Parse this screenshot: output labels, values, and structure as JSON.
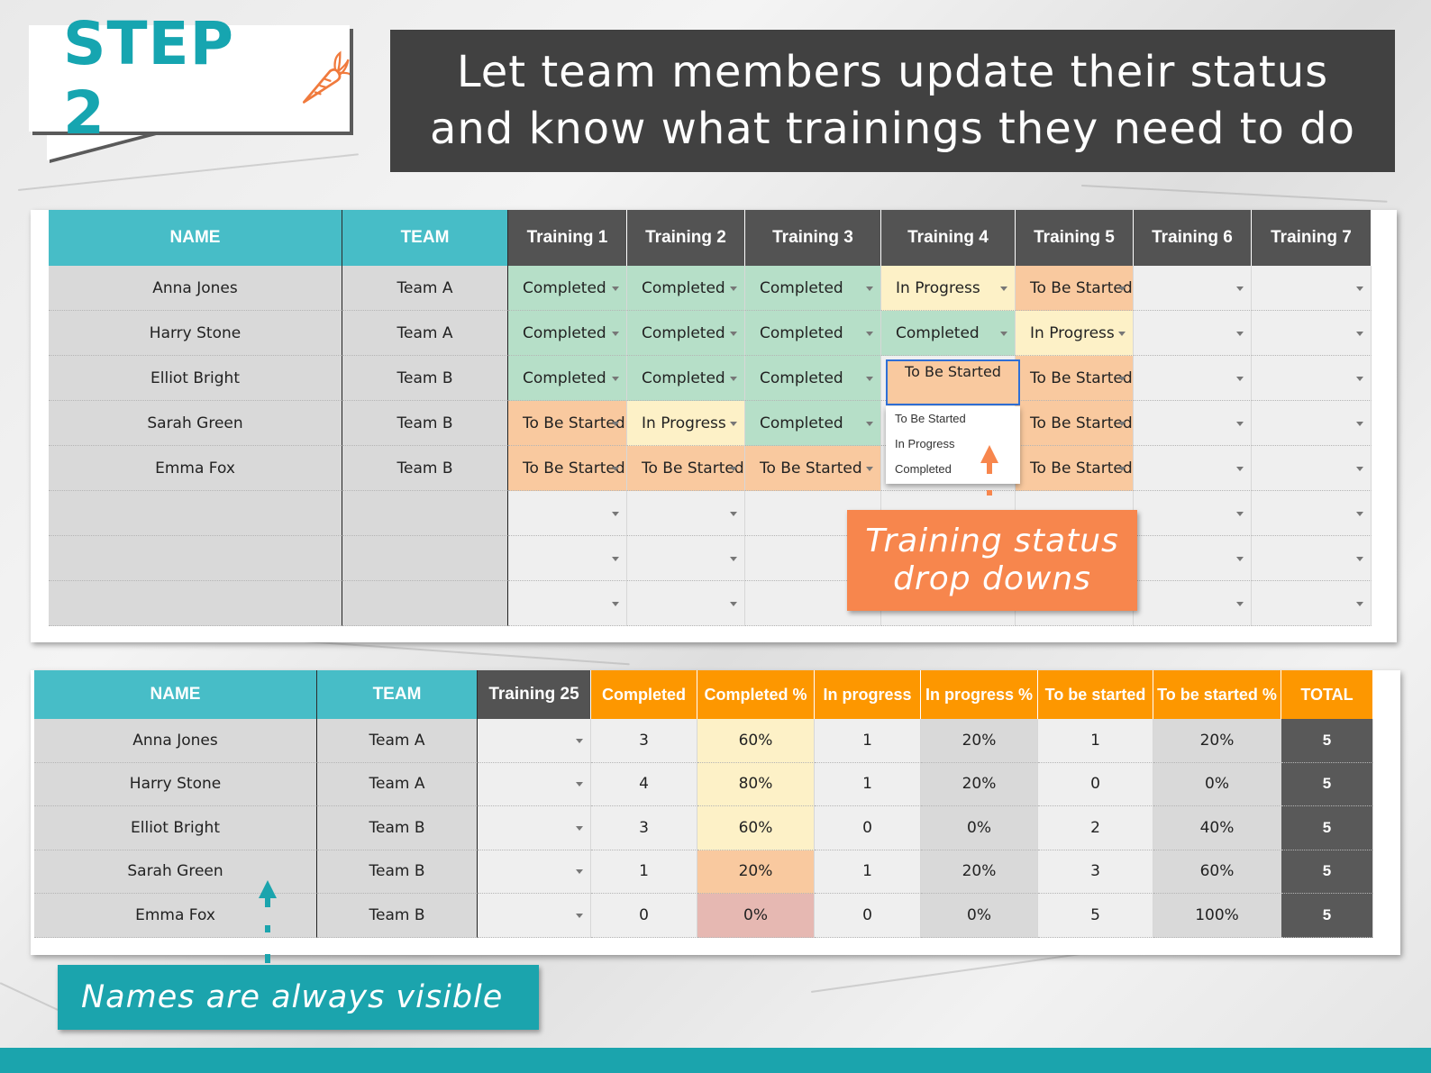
{
  "step": {
    "label": "STEP 2"
  },
  "banner": {
    "line1": "Let team members update their status",
    "line2": "and know what trainings they need to do"
  },
  "top_table": {
    "headers": [
      "NAME",
      "TEAM",
      "Training 1",
      "Training 2",
      "Training 3",
      "Training 4",
      "Training 5",
      "Training 6",
      "Training 7"
    ],
    "rows": [
      {
        "name": "Anna Jones",
        "team": "Team A",
        "statuses": [
          "Completed",
          "Completed",
          "Completed",
          "In Progress",
          "To Be Started",
          "",
          ""
        ]
      },
      {
        "name": "Harry Stone",
        "team": "Team A",
        "statuses": [
          "Completed",
          "Completed",
          "Completed",
          "Completed",
          "In Progress",
          "",
          ""
        ]
      },
      {
        "name": "Elliot Bright",
        "team": "Team B",
        "statuses": [
          "Completed",
          "Completed",
          "Completed",
          "",
          "To Be Started",
          "",
          ""
        ]
      },
      {
        "name": "Sarah Green",
        "team": "Team B",
        "statuses": [
          "To Be Started",
          "In Progress",
          "Completed",
          "",
          "To Be Started",
          "",
          ""
        ]
      },
      {
        "name": "Emma Fox",
        "team": "Team B",
        "statuses": [
          "To Be Started",
          "To Be Started",
          "To Be Started",
          "",
          "To Be Started",
          "",
          ""
        ]
      },
      {
        "name": "",
        "team": "",
        "statuses": [
          "",
          "",
          "",
          "",
          "",
          "",
          ""
        ]
      },
      {
        "name": "",
        "team": "",
        "statuses": [
          "",
          "",
          "",
          "",
          "",
          "",
          ""
        ]
      },
      {
        "name": "",
        "team": "",
        "statuses": [
          "",
          "",
          "",
          "",
          "",
          "",
          ""
        ]
      }
    ]
  },
  "dropdown": {
    "selected": "To Be Started",
    "options": [
      "To Be Started",
      "In Progress",
      "Completed"
    ]
  },
  "bottom_table": {
    "headers": [
      "NAME",
      "TEAM",
      "Training 25",
      "Completed",
      "Completed %",
      "In progress",
      "In progress %",
      "To be started",
      "To be started %",
      "TOTAL"
    ],
    "rows": [
      {
        "name": "Anna Jones",
        "team": "Team A",
        "t25": "",
        "completed": "3",
        "completed_pct": "60%",
        "in_progress": "1",
        "in_progress_pct": "20%",
        "to_be_started": "1",
        "to_be_started_pct": "20%",
        "total": "5"
      },
      {
        "name": "Harry Stone",
        "team": "Team A",
        "t25": "",
        "completed": "4",
        "completed_pct": "80%",
        "in_progress": "1",
        "in_progress_pct": "20%",
        "to_be_started": "0",
        "to_be_started_pct": "0%",
        "total": "5"
      },
      {
        "name": "Elliot Bright",
        "team": "Team B",
        "t25": "",
        "completed": "3",
        "completed_pct": "60%",
        "in_progress": "0",
        "in_progress_pct": "0%",
        "to_be_started": "2",
        "to_be_started_pct": "40%",
        "total": "5"
      },
      {
        "name": "Sarah Green",
        "team": "Team B",
        "t25": "",
        "completed": "1",
        "completed_pct": "20%",
        "in_progress": "1",
        "in_progress_pct": "20%",
        "to_be_started": "3",
        "to_be_started_pct": "60%",
        "total": "5"
      },
      {
        "name": "Emma Fox",
        "team": "Team B",
        "t25": "",
        "completed": "0",
        "completed_pct": "0%",
        "in_progress": "0",
        "in_progress_pct": "0%",
        "to_be_started": "5",
        "to_be_started_pct": "100%",
        "total": "5"
      }
    ]
  },
  "callouts": {
    "status_line1": "Training status",
    "status_line2": "drop downs",
    "names": "Names are always visible"
  },
  "colors": {
    "teal": "#47bdc7",
    "dark_header": "#535353",
    "orange_header": "#fd9700",
    "completed": "#b6dfc8",
    "in_progress": "#fdf1c7",
    "to_be_started": "#f9c99f",
    "callout_orange": "#f7864d",
    "callout_teal": "#1ba4ad"
  }
}
